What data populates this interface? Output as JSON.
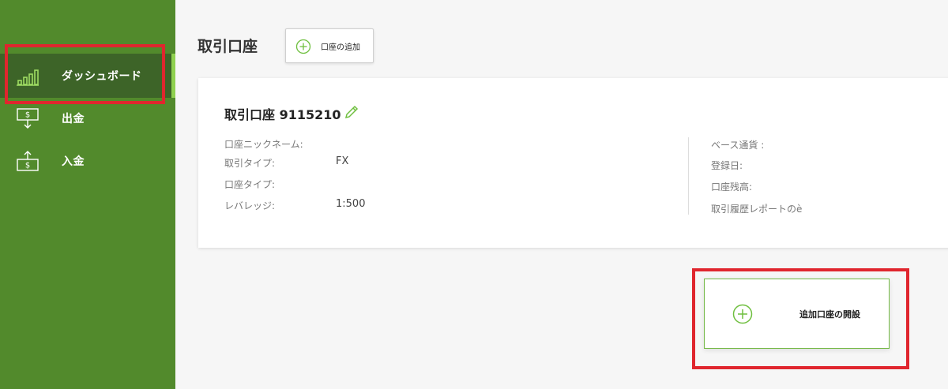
{
  "sidebar": {
    "items": [
      {
        "label": "ダッシュボード",
        "icon": "bar-chart-icon",
        "active": true
      },
      {
        "label": "出金",
        "icon": "withdraw-icon",
        "active": false
      },
      {
        "label": "入金",
        "icon": "deposit-icon",
        "active": false
      }
    ]
  },
  "main": {
    "title": "取引口座",
    "add_account_label": "口座の追加",
    "account": {
      "title": "取引口座 9115210",
      "left_fields": [
        {
          "label": "口座ニックネーム:",
          "value": ""
        },
        {
          "label": "取引タイプ:",
          "value": "FX"
        },
        {
          "label": "口座タイプ:",
          "value": ""
        },
        {
          "label": "レバレッジ:",
          "value": "1:500"
        }
      ],
      "right_fields": [
        {
          "label": "ベース通貨 :"
        },
        {
          "label": "登録日:"
        },
        {
          "label": "口座残高:"
        },
        {
          "label": "取引履歴レポートのè"
        }
      ]
    },
    "open_account_label": "追加口座の開設"
  },
  "colors": {
    "sidebar": "#528a2c",
    "sidebar_active": "#3d6428",
    "accent": "#72b843",
    "highlight": "#e0262e"
  }
}
